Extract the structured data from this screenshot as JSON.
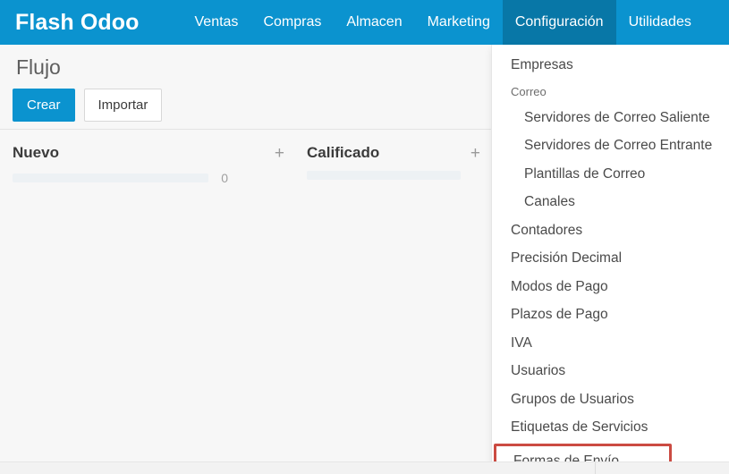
{
  "navbar": {
    "brand": "Flash Odoo",
    "items": [
      {
        "label": "Ventas",
        "active": false
      },
      {
        "label": "Compras",
        "active": false
      },
      {
        "label": "Almacen",
        "active": false
      },
      {
        "label": "Marketing",
        "active": false
      },
      {
        "label": "Configuración",
        "active": true
      },
      {
        "label": "Utilidades",
        "active": false
      }
    ],
    "background": "#0b93cf",
    "active_background": "#0877a7"
  },
  "control_panel": {
    "breadcrumb": "Flujo",
    "create_label": "Crear",
    "import_label": "Importar"
  },
  "kanban": {
    "columns": [
      {
        "title": "Nuevo",
        "add_icon": "+",
        "count": "0"
      },
      {
        "title": "Calificado",
        "add_icon": "+",
        "count": ""
      }
    ]
  },
  "dropdown": {
    "owner": "Configuración",
    "highlight_color": "#cb4b42",
    "entries": [
      {
        "label": "Empresas",
        "type": "item"
      },
      {
        "label": "Correo",
        "type": "section"
      },
      {
        "label": "Servidores de Correo Saliente",
        "type": "sub"
      },
      {
        "label": "Servidores de Correo Entrante",
        "type": "sub"
      },
      {
        "label": "Plantillas de Correo",
        "type": "sub"
      },
      {
        "label": "Canales",
        "type": "sub"
      },
      {
        "label": "Contadores",
        "type": "item"
      },
      {
        "label": "Precisión Decimal",
        "type": "item"
      },
      {
        "label": "Modos de Pago",
        "type": "item"
      },
      {
        "label": "Plazos de Pago",
        "type": "item"
      },
      {
        "label": "IVA",
        "type": "item"
      },
      {
        "label": "Usuarios",
        "type": "item"
      },
      {
        "label": "Grupos de Usuarios",
        "type": "item"
      },
      {
        "label": "Etiquetas de Servicios",
        "type": "item"
      },
      {
        "label": "Formas de Envío",
        "type": "highlight"
      }
    ]
  }
}
